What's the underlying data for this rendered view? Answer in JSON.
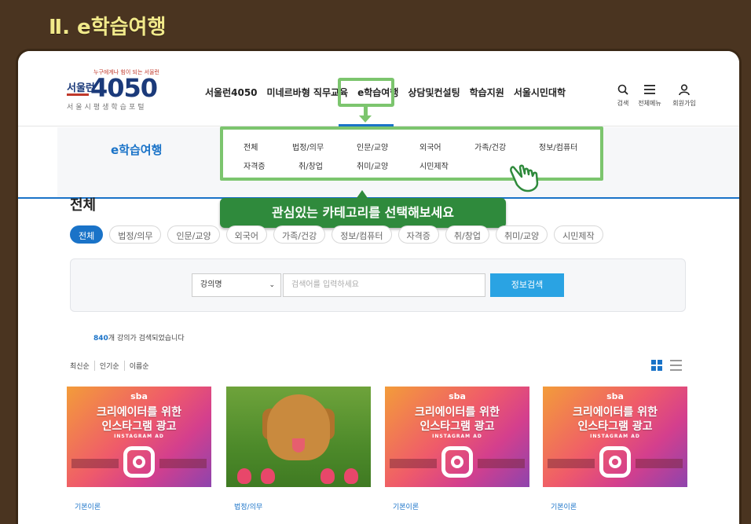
{
  "frame_title": "Ⅱ. e학습여행",
  "logo": {
    "slogan": "누구에게나 힘이 되는 서울런",
    "seoul": "서울런",
    "num": "4050",
    "sub": "서울시평생학습포털"
  },
  "gnb": [
    "서울런4050",
    "미네르바형 직무교육",
    "e학습여행",
    "상담및컨설팅",
    "학습지원",
    "서울시민대학"
  ],
  "util": [
    {
      "icon": "search-icon",
      "label": "검색"
    },
    {
      "icon": "menu-icon",
      "label": "전체메뉴"
    },
    {
      "icon": "user-icon",
      "label": "회원가입"
    }
  ],
  "submenu_title": "e학습여행",
  "categories_row1": [
    "전체",
    "법정/의무",
    "인문/교양",
    "외국어",
    "가족/건강",
    "정보/컴퓨터"
  ],
  "categories_row2": [
    "자격증",
    "취/창업",
    "취미/교양",
    "시민제작"
  ],
  "banner": "관심있는 카테고리를 선택해보세요",
  "page_heading": "전체",
  "chips": [
    "전체",
    "법정/의무",
    "인문/교양",
    "외국어",
    "가족/건강",
    "정보/컴퓨터",
    "자격증",
    "취/창업",
    "취미/교양",
    "시민제작"
  ],
  "search": {
    "select_value": "강의명",
    "placeholder": "검색어를 입력하세요",
    "button": "정보검색"
  },
  "result": {
    "count": "840",
    "suffix": "개 강의가 검색되었습니다"
  },
  "sorts": [
    "최신순",
    "인기순",
    "이름순"
  ],
  "ad": {
    "brand": "sba",
    "line1": "크리에이터를 위한",
    "line2": "인스타그램 광고",
    "tag": "INSTAGRAM AD"
  },
  "cards": [
    {
      "thumb": "ad",
      "category": "기본이론"
    },
    {
      "thumb": "dog",
      "category": "법정/의무"
    },
    {
      "thumb": "ad",
      "category": "기본이론"
    },
    {
      "thumb": "ad",
      "category": "기본이론"
    }
  ],
  "colors": {
    "accent": "#1a73c8",
    "highlight": "#7cc56e",
    "banner": "#2f8a3c",
    "frame": "#4a3420"
  }
}
